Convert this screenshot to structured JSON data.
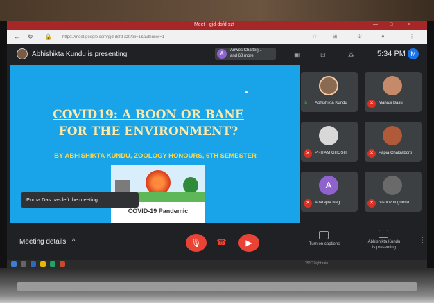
{
  "browser": {
    "tab_title": "Meet - gjd-dsfd-xzt",
    "url": "https://meet.google.com/gjd-dsfd-xzt?pli=1&authuser=1",
    "window_controls": [
      "—",
      "□",
      "×"
    ]
  },
  "meet": {
    "presenting_banner": "Abhishikta Kundu is presenting",
    "participants_chip": {
      "avatar_letter": "A",
      "line1": "Anwes Chatterj...",
      "line2": "and 68 more"
    },
    "clock": "5:34 PM",
    "user_avatar_letter": "M"
  },
  "slide": {
    "title_line1": "COVID19: A BOON OR BANE",
    "title_line2": "FOR THE ENVIRONMENT?",
    "subtitle": "BY ABHISHIKTA KUNDU, ZOOLOGY HONOURS, 6TH SEMESTER",
    "image_caption": "COVID-19 Pandemic"
  },
  "toast": "Purna Das has left the meeting",
  "participants": [
    {
      "name": "Abhishikta Kundu",
      "speaking": true,
      "avatar_color": "#8a6a50"
    },
    {
      "name": "Manasi Basu",
      "speaking": false,
      "avatar_color": "#c48a6a"
    },
    {
      "name": "PRITAM GHOSH",
      "speaking": false,
      "avatar_color": "#d8d8d8"
    },
    {
      "name": "Papia Chakraborti",
      "speaking": false,
      "avatar_color": "#b05a3a"
    },
    {
      "name": "Aparajita Nag",
      "speaking": false,
      "avatar_color": "#8e63ce",
      "letter": "A"
    },
    {
      "name": "Nishi Pulugurtha",
      "speaking": false,
      "avatar_color": "#6a6a6a"
    }
  ],
  "bottom": {
    "meeting_details": "Meeting details",
    "captions_label": "Turn on captions",
    "presenting_label_1": "Abhishikta Kundu",
    "presenting_label_2": "is presenting"
  },
  "taskbar": {
    "tray_text": "29°C Light rain"
  }
}
